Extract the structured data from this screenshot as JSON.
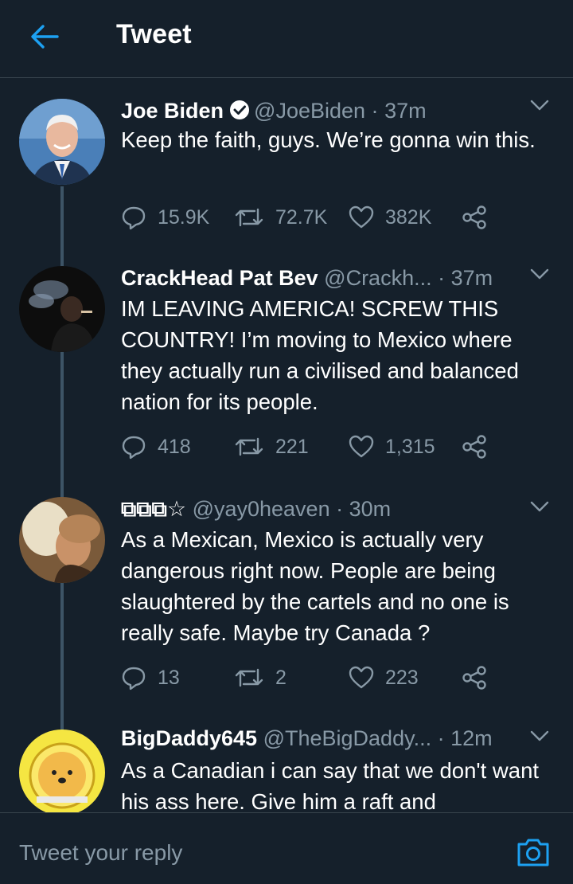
{
  "header": {
    "title": "Tweet",
    "back_icon": "arrow-left-icon",
    "accent_color": "#1da1f2"
  },
  "tweets": [
    {
      "name": "Joe Biden",
      "verified": true,
      "handle": "@JoeBiden",
      "dot": "·",
      "time": "37m",
      "text": "Keep the faith, guys. We’re gonna win this.",
      "replies": "15.9K",
      "retweets": "72.7K",
      "likes": "382K"
    },
    {
      "name": "CrackHead Pat Bev",
      "verified": false,
      "handle": "@Crackh...",
      "dot": "·",
      "time": "37m",
      "text": "IM LEAVING AMERICA! SCREW THIS COUNTRY! I’m moving to Mexico where they actually run a civilised and balanced nation for its people.",
      "replies": "418",
      "retweets": "221",
      "likes": "1,315"
    },
    {
      "name": "⧉⧉⧉☆",
      "verified": false,
      "handle": "@yay0heaven",
      "dot": "·",
      "time": "30m",
      "text": "As a Mexican, Mexico is actually very dangerous right now. People are being slaughtered by the cartels and no one is really safe. Maybe try Canada ?",
      "replies": "13",
      "retweets": "2",
      "likes": "223"
    },
    {
      "name": "BigDaddy645",
      "verified": false,
      "handle": "@TheBigDaddy...",
      "dot": "·",
      "time": "12m",
      "text": "As a Canadian i can say that we don't want his ass here. Give him a raft and"
    }
  ],
  "reply_bar": {
    "placeholder": "Tweet your reply",
    "camera_icon": "camera-icon"
  }
}
